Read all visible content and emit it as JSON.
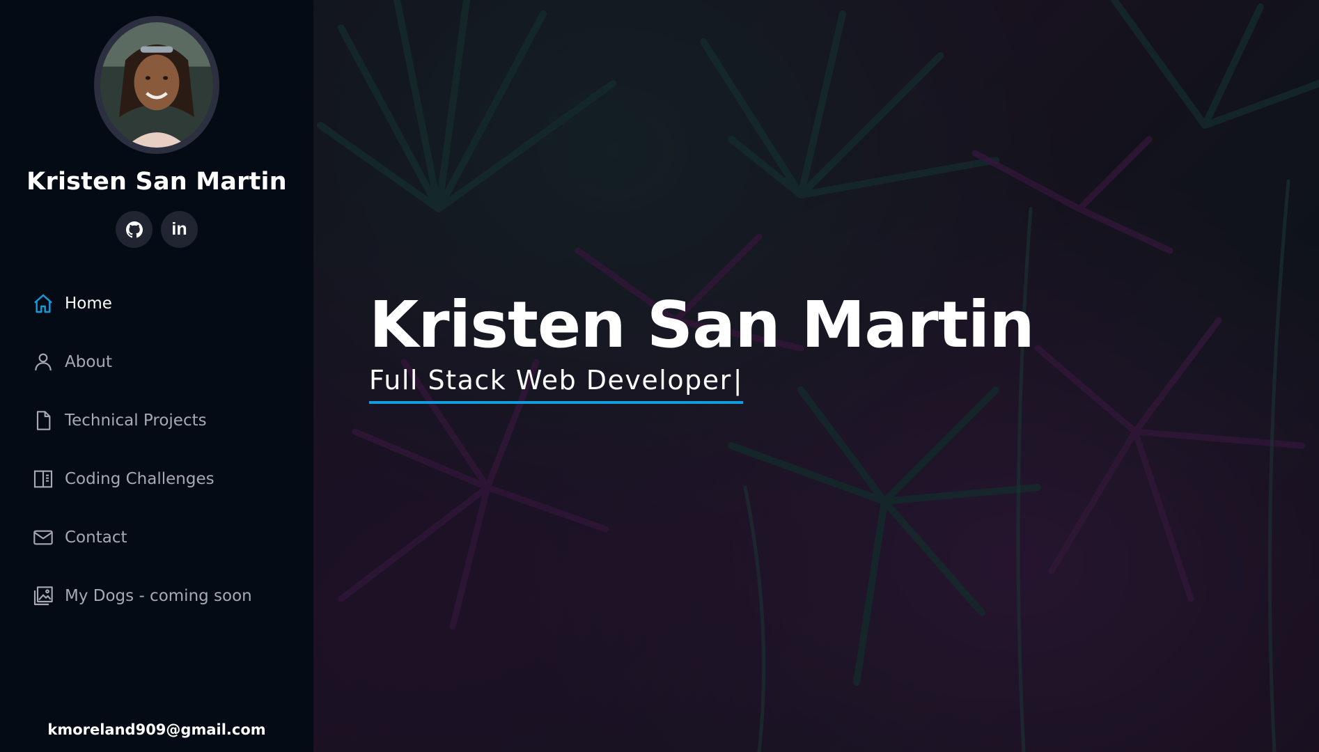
{
  "profile": {
    "name": "Kristen San Martin",
    "email": "kmoreland909@gmail.com"
  },
  "social": [
    {
      "name": "github",
      "icon": "github-icon"
    },
    {
      "name": "linkedin",
      "icon": "linkedin-icon",
      "glyph": "in"
    }
  ],
  "nav": {
    "items": [
      {
        "label": "Home",
        "icon": "home-icon",
        "active": true
      },
      {
        "label": "About",
        "icon": "person-icon",
        "active": false
      },
      {
        "label": "Technical Projects",
        "icon": "file-icon",
        "active": false
      },
      {
        "label": "Coding Challenges",
        "icon": "layout-icon",
        "active": false
      },
      {
        "label": "Contact",
        "icon": "envelope-icon",
        "active": false
      },
      {
        "label": "My Dogs - coming soon",
        "icon": "images-icon",
        "active": false
      }
    ]
  },
  "hero": {
    "title": "Kristen San Martin",
    "subtitle": "Full Stack Web Developer",
    "cursor": "|"
  },
  "colors": {
    "accent": "#149ddd",
    "sidebar_bg": "#040b14",
    "social_bg": "#212431",
    "nav_text": "#a8a9b4"
  }
}
